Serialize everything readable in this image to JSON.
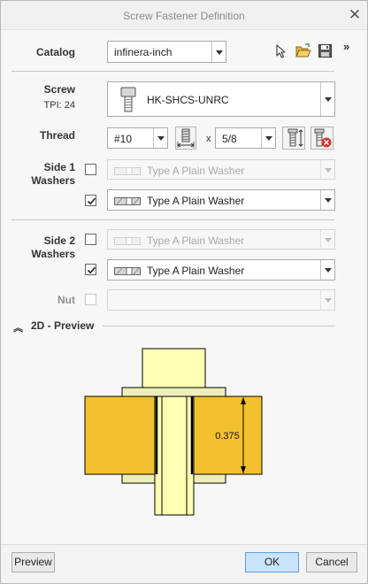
{
  "window": {
    "title": "Screw Fastener Definition"
  },
  "catalog": {
    "label": "Catalog",
    "value": "infinera-inch"
  },
  "screw": {
    "label": "Screw",
    "tpi": "TPI: 24",
    "value": "HK-SHCS-UNRC"
  },
  "thread": {
    "label": "Thread",
    "size": "#10",
    "times": "x",
    "length": "5/8"
  },
  "side1": {
    "label_line1": "Side 1",
    "label_line2": "Washers",
    "rows": [
      {
        "checked": false,
        "enabled": false,
        "value": "Type A Plain Washer"
      },
      {
        "checked": true,
        "enabled": true,
        "value": "Type A Plain Washer"
      }
    ]
  },
  "side2": {
    "label_line1": "Side 2",
    "label_line2": "Washers",
    "rows": [
      {
        "checked": false,
        "enabled": false,
        "value": "Type A Plain Washer"
      },
      {
        "checked": true,
        "enabled": true,
        "value": "Type A Plain Washer"
      }
    ]
  },
  "nut": {
    "label": "Nut",
    "checked": false,
    "enabled": false,
    "value": ""
  },
  "preview": {
    "title": "2D - Preview",
    "dimension": "0.375",
    "colors": {
      "plate": "#f3c130",
      "bolt": "#ffffb4",
      "washer": "#eeeebb",
      "outline": "#000000"
    }
  },
  "buttons": {
    "preview": "Preview",
    "ok": "OK",
    "cancel": "Cancel"
  },
  "icons": {
    "close": "close-icon",
    "expand": "double-chevron-right-icon",
    "select": "arrow-pointer-icon",
    "open": "open-folder-icon",
    "save": "save-disk-icon",
    "screw_head": "screw-head-icon",
    "thread_length": "thread-length-icon",
    "screw_thread": "screw-thread-icon",
    "screw_error": "screw-error-icon",
    "washer": "washer-icon",
    "collapse": "double-chevron-up-icon"
  }
}
